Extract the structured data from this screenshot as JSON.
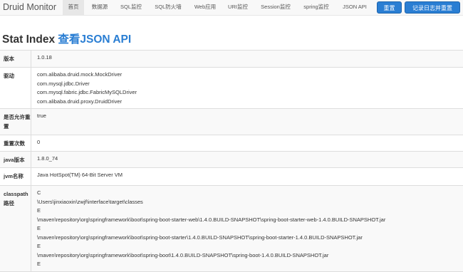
{
  "nav": {
    "brand": "Druid Monitor",
    "items": [
      "首页",
      "数据源",
      "SQL监控",
      "SQL防火墙",
      "Web应用",
      "URI监控",
      "Session监控",
      "spring监控",
      "JSON API"
    ],
    "reset_label": "重置",
    "log_reset_label": "记录日志并重置"
  },
  "page": {
    "title": "Stat Index",
    "json_link": "查看JSON API"
  },
  "stats": {
    "version": {
      "label": "版本",
      "value": "1.0.18"
    },
    "drivers": {
      "label": "驱动",
      "values": [
        "com.alibaba.druid.mock.MockDriver",
        "com.mysql.jdbc.Driver",
        "com.mysql.fabric.jdbc.FabricMySQLDriver",
        "com.alibaba.druid.proxy.DruidDriver"
      ]
    },
    "reset_enable": {
      "label": "是否允许重置",
      "value": "true"
    },
    "reset_count": {
      "label": "重置次数",
      "value": "0"
    },
    "java_version": {
      "label": "java版本",
      "value": "1.8.0_74"
    },
    "jvm_name": {
      "label": "jvm名称",
      "value": "Java HotSpot(TM) 64-Bit Server VM"
    },
    "classpath": {
      "label": "classpath路径",
      "values": [
        "C",
        "\\Users\\jinxiaoxin\\zwjf\\interface\\target\\classes",
        "E",
        "\\maven\\repository\\org\\springframework\\boot\\spring-boot-starter-web\\1.4.0.BUILD-SNAPSHOT\\spring-boot-starter-web-1.4.0.BUILD-SNAPSHOT.jar",
        "E",
        "\\maven\\repository\\org\\springframework\\boot\\spring-boot-starter\\1.4.0.BUILD-SNAPSHOT\\spring-boot-starter-1.4.0.BUILD-SNAPSHOT.jar",
        "E",
        "\\maven\\repository\\org\\springframework\\boot\\spring-boot\\1.4.0.BUILD-SNAPSHOT\\spring-boot-1.4.0.BUILD-SNAPSHOT.jar",
        "E"
      ]
    }
  }
}
